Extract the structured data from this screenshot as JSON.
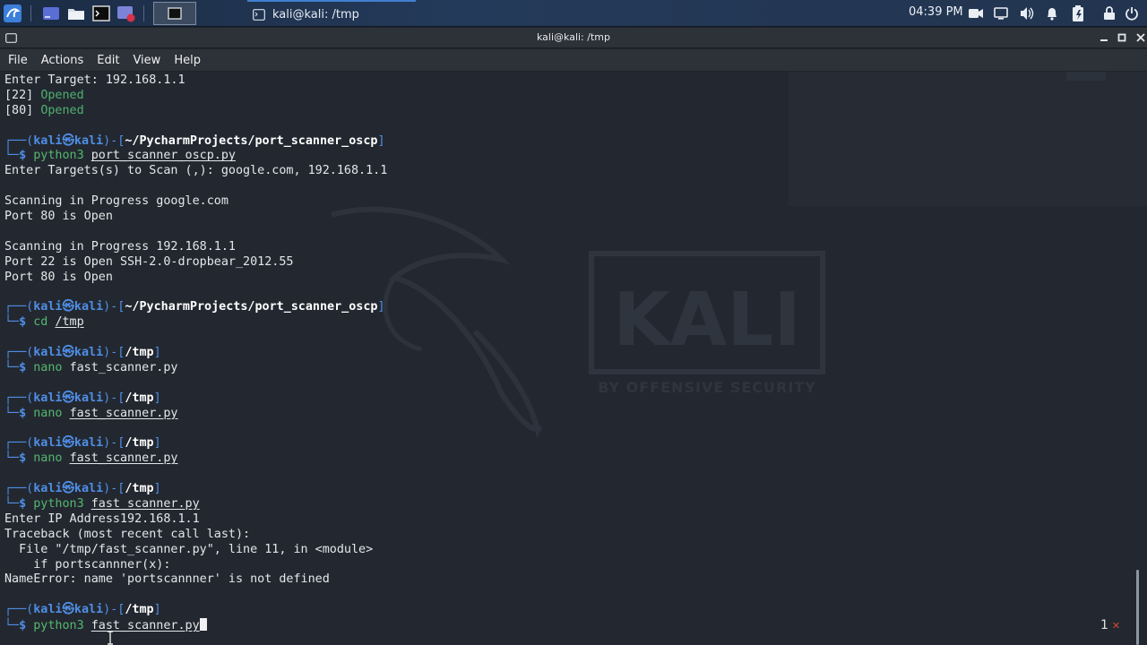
{
  "taskbar": {
    "task_title": "kali@kali: /tmp",
    "clock": "04:39 PM"
  },
  "window": {
    "title": "kali@kali: /tmp",
    "menu": [
      "File",
      "Actions",
      "Edit",
      "View",
      "Help"
    ]
  },
  "prompt": {
    "user": "kali",
    "host": "kali",
    "symbol": "㉿"
  },
  "terminal": {
    "line0": "Enter Target: 192.168.1.1",
    "line1_port": "[22]",
    "line1_status": "Opened",
    "line2_port": "[80]",
    "line2_status": "Opened",
    "p1_path": "~/PycharmProjects/port_scanner_oscp",
    "p1_cmd": "python3",
    "p1_arg": "port_scanner_oscp.py",
    "out1": "Enter Targets(s) to Scan (,): google.com, 192.168.1.1",
    "out2": "Scanning in Progress google.com",
    "out3": "Port 80 is Open",
    "out4": "Scanning in Progress 192.168.1.1",
    "out5": "Port 22 is Open SSH-2.0-dropbear_2012.55",
    "out6": "Port 80 is Open",
    "p2_path": "~/PycharmProjects/port_scanner_oscp",
    "p2_cmd": "cd",
    "p2_arg": "/tmp",
    "p3_path": "/tmp",
    "p3_cmd": "nano",
    "p3_arg": "fast_scanner.py",
    "p4_path": "/tmp",
    "p4_cmd": "nano",
    "p4_arg": "fast_scanner.py",
    "p5_path": "/tmp",
    "p5_cmd": "nano",
    "p5_arg": "fast_scanner.py",
    "p6_path": "/tmp",
    "p6_cmd": "python3",
    "p6_arg": "fast_scanner.py",
    "err1": "Enter IP Address192.168.1.1",
    "err2": "Traceback (most recent call last):",
    "err3": "  File \"/tmp/fast_scanner.py\", line 11, in <module>",
    "err4": "    if portscannner(x):",
    "err5": "NameError: name 'portscannner' is not defined",
    "p7_path": "/tmp",
    "p7_cmd": "python3",
    "p7_arg": "fast_scanner.py"
  },
  "wallpaper": {
    "logo_text": "KALI",
    "tagline": "BY OFFENSIVE SECURITY"
  },
  "page_indicator": "1",
  "colors": {
    "prompt_blue": "#4f8ee6",
    "green": "#54b86f",
    "background": "#232830",
    "taskbar": "#22344f"
  }
}
